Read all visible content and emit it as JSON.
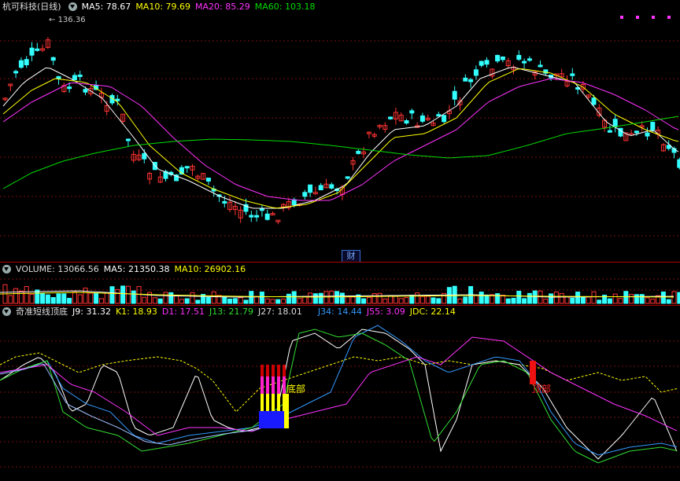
{
  "main": {
    "title": "杭可科技(日线)",
    "ma5": "MA5: 78.67",
    "ma10": "MA10: 79.69",
    "ma20": "MA20: 85.29",
    "ma60": "MA60: 103.18",
    "high_marker": "136.36",
    "fin_label": "财",
    "colors": {
      "ma5": "#ffffff",
      "ma10": "#ffff00",
      "ma20": "#ff33ff",
      "ma60": "#00dd00",
      "up": "#ff3333",
      "down": "#33ffff"
    }
  },
  "volume": {
    "label": "VOLUME: 13066.56",
    "ma5": "MA5: 21350.38",
    "ma10": "MA10: 26902.16"
  },
  "indicator": {
    "title": "奇准短线顶底",
    "j9": "J9: 31.32",
    "k1": "K1: 18.93",
    "d1": "D1: 17.51",
    "j13": "J13: 21.79",
    "j27": "J27: 18.01",
    "j34": "J34: 14.44",
    "j55": "J55: 3.09",
    "jdc": "JDC: 22.14",
    "bottom_label": "底部",
    "top_label": "顶部"
  }
}
